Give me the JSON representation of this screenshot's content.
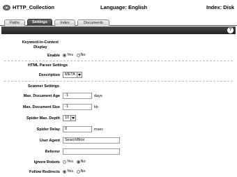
{
  "header": {
    "app_title": "HTTP_Collection",
    "language_label": "Language: English",
    "index_label": "Index: Disk"
  },
  "tabs": [
    {
      "label": "Paths",
      "active": false
    },
    {
      "label": "Settings",
      "active": true
    },
    {
      "label": "Index",
      "active": false
    },
    {
      "label": "Documents",
      "active": false
    }
  ],
  "toolbar": {
    "help_icon": "help-icon",
    "help_text": "?"
  },
  "form": {
    "keyword_in_context": {
      "label_line1": "Keyword-in-Context",
      "label_line2": "Display"
    },
    "enable": {
      "label": "Enable",
      "options": [
        "Yes",
        "No"
      ],
      "selected": "Yes"
    },
    "html_parser_section": "HTML Parser Settings",
    "description": {
      "label": "Description",
      "value": "META"
    },
    "scanner_section": "Scanner Settings",
    "max_document_age": {
      "label": "Max. Document Age",
      "value": "-1",
      "unit": "days"
    },
    "max_document_size": {
      "label": "Max. Document Size",
      "value": "-1",
      "unit": "kb"
    },
    "spider_max_depth": {
      "label": "Spider Max. Depth",
      "value": "10"
    },
    "spider_delay": {
      "label": "Spider Delay",
      "value": "0",
      "unit": "msec"
    },
    "user_agent": {
      "label": "User Agent",
      "value": "SearchBlox"
    },
    "referrer": {
      "label": "Referrer",
      "value": ""
    },
    "ignore_robots": {
      "label": "Ignore Robots",
      "options": [
        "Yes",
        "No"
      ],
      "selected": "No"
    },
    "follow_redirects": {
      "label": "Follow Redirects",
      "options": [
        "Yes",
        "No"
      ],
      "selected": "Yes"
    }
  }
}
